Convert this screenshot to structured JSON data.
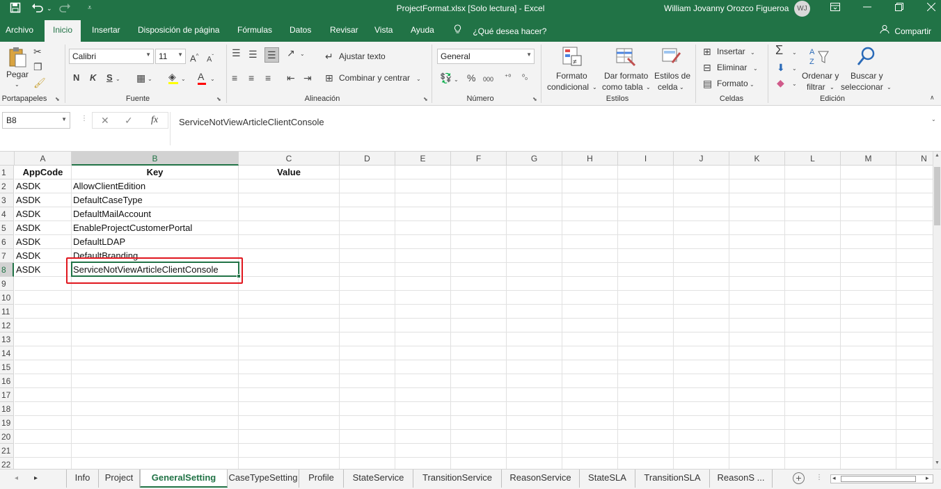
{
  "titlebar": {
    "title": "ProjectFormat.xlsx  [Solo lectura]  -  Excel",
    "user": "William Jovanny Orozco Figueroa",
    "initials": "WJ",
    "undo_icon": "undo-icon",
    "redo_icon": "redo-icon",
    "save_icon": "save-icon"
  },
  "menu": {
    "tabs": [
      "Archivo",
      "Inicio",
      "Insertar",
      "Disposición de página",
      "Fórmulas",
      "Datos",
      "Revisar",
      "Vista",
      "Ayuda"
    ],
    "tellme": "¿Qué desea hacer?",
    "share": "Compartir"
  },
  "ribbon": {
    "clipboard": {
      "paste": "Pegar",
      "label": "Portapapeles"
    },
    "font": {
      "name": "Calibri",
      "size": "11",
      "bold": "N",
      "italic": "K",
      "underline": "S",
      "label": "Fuente"
    },
    "alignment": {
      "wrap": "Ajustar texto",
      "merge": "Combinar y centrar",
      "label": "Alineación"
    },
    "number": {
      "format": "General",
      "label": "Número"
    },
    "styles": {
      "conditional_1": "Formato",
      "conditional_2": "condicional",
      "table_1": "Dar formato",
      "table_2": "como tabla",
      "cell_1": "Estilos de",
      "cell_2": "celda",
      "label": "Estilos"
    },
    "cells": {
      "insert": "Insertar",
      "delete": "Eliminar",
      "format": "Formato",
      "label": "Celdas"
    },
    "editing": {
      "sort_1": "Ordenar y",
      "sort_2": "filtrar",
      "find_1": "Buscar y",
      "find_2": "seleccionar",
      "label": "Edición"
    }
  },
  "formula_bar": {
    "name_box": "B8",
    "content": "ServiceNotViewArticleClientConsole"
  },
  "grid": {
    "columns": [
      "A",
      "B",
      "C",
      "D",
      "E",
      "F",
      "G",
      "H",
      "I",
      "J",
      "K",
      "L",
      "M",
      "N"
    ],
    "rows": [
      "1",
      "2",
      "3",
      "4",
      "5",
      "6",
      "7",
      "8",
      "9",
      "10",
      "11",
      "12",
      "13",
      "14",
      "15",
      "16",
      "17",
      "18",
      "19",
      "20",
      "21",
      "22"
    ],
    "headers": [
      "AppCode",
      "Key",
      "Value"
    ],
    "data": [
      [
        "ASDK",
        "AllowClientEdition"
      ],
      [
        "ASDK",
        "DefaultCaseType"
      ],
      [
        "ASDK",
        "DefaultMailAccount"
      ],
      [
        "ASDK",
        "EnableProjectCustomerPortal"
      ],
      [
        "ASDK",
        "DefaultLDAP"
      ],
      [
        "ASDK",
        "DefaultBranding"
      ],
      [
        "ASDK",
        "ServiceNotViewArticleClientConsole"
      ]
    ],
    "active_cell": "B8"
  },
  "sheets": {
    "tabs": [
      "Info",
      "Project",
      "GeneralSetting",
      "CaseTypeSetting",
      "Profile",
      "StateService",
      "TransitionService",
      "ReasonService",
      "StateSLA",
      "TransitionSLA",
      "ReasonS ..."
    ],
    "active": "GeneralSetting"
  },
  "colors": {
    "brand": "#217346",
    "highlight": "#e0161e"
  }
}
